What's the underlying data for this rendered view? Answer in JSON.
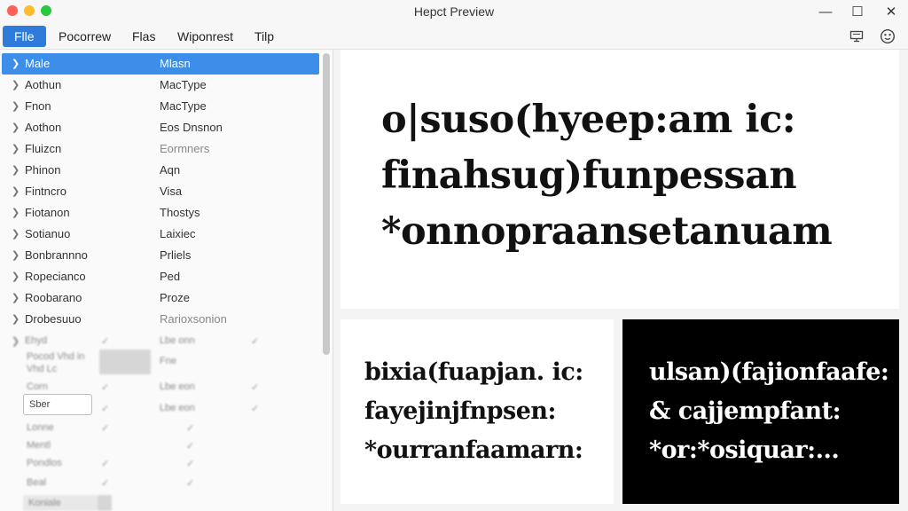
{
  "window": {
    "title": "Hepct Preview"
  },
  "controls": {
    "minimize": "—",
    "maximize": "☐",
    "close": "✕"
  },
  "menu": [
    {
      "label": "Flle"
    },
    {
      "label": "Pocorrew"
    },
    {
      "label": "Flas"
    },
    {
      "label": "Wiponrest"
    },
    {
      "label": "Tilp"
    }
  ],
  "toolbar": {
    "icons": [
      "monitor-icon",
      "smiley-icon"
    ]
  },
  "sidebar": {
    "rows": [
      {
        "name": "Male",
        "value": "Mlasn",
        "selected": true
      },
      {
        "name": "Aothun",
        "value": "MacType"
      },
      {
        "name": "Fnon",
        "value": "MacType"
      },
      {
        "name": "Aothon",
        "value": "Eos Dnsnon"
      },
      {
        "name": "Fluizcn",
        "value": "Eormners"
      },
      {
        "name": "Phinon",
        "value": "Aqn"
      },
      {
        "name": "Fintncro",
        "value": "Visa"
      },
      {
        "name": "Fiotanon",
        "value": "Thostys"
      },
      {
        "name": "Sotianuo",
        "value": "Laixiec"
      },
      {
        "name": "Bonbrannno",
        "value": "Prliels"
      },
      {
        "name": "Ropecianco",
        "value": "Ped"
      },
      {
        "name": "Roobarano",
        "value": "Proze"
      },
      {
        "name": "Drobesuuo",
        "value": "Rarioxsonion"
      }
    ],
    "blurred": {
      "row1": "Ehyd",
      "row2a": "Pocod Vhd in",
      "row2b": "Vhd Lc",
      "row3": "Corn",
      "field": "Sber",
      "row4": "Lonne",
      "row5": "Mentl",
      "row6": "Pondlos",
      "row7": "Beal",
      "row8": "Koniale",
      "value1": "Lbe onn",
      "value2": "Fne",
      "value3": "Lbe eon"
    }
  },
  "preview": {
    "top": [
      "o|suso(hyeep:am ic:",
      "finahsug)funpessan",
      "*onnopraansetanuam"
    ],
    "bottom_left": [
      "bixia(fuapjan. ic:",
      "fayejinjfnpsen:",
      "*ourranfaamarn:"
    ],
    "bottom_right": [
      "ulsan)(fajionfaafe:",
      "& cajjempfant:",
      "*or:*osiquar:..."
    ]
  },
  "colors": {
    "accent": "#2f7bd9",
    "selection": "#3d8ee8"
  }
}
